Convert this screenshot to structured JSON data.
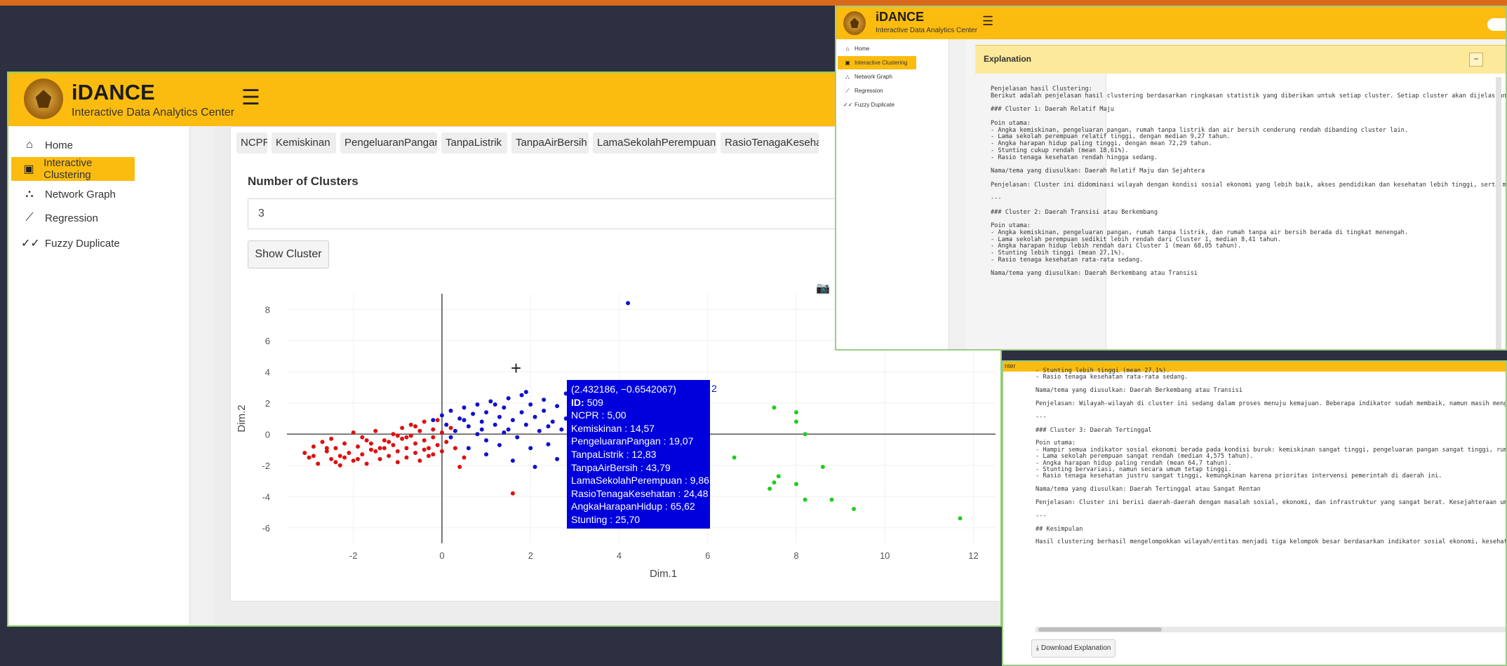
{
  "app": {
    "brand": "iDANCE",
    "subtitle": "Interactive Data Analytics Center"
  },
  "nav": {
    "items": [
      {
        "label": "Home",
        "icon": "home-icon"
      },
      {
        "label": "Interactive Clustering",
        "icon": "clustering-icon"
      },
      {
        "label": "Network Graph",
        "icon": "network-icon"
      },
      {
        "label": "Regression",
        "icon": "line-chart-icon"
      },
      {
        "label": "Fuzzy Duplicate",
        "icon": "double-check-icon"
      }
    ],
    "active_index": 1
  },
  "clustering": {
    "variables": [
      "NCPR",
      "Kemiskinan",
      "PengeluaranPangan",
      "TanpaListrik",
      "TanpaAirBersih",
      "LamaSekolahPerempuan",
      "RasioTenagaKesehatan"
    ],
    "num_clusters_label": "Number of Clusters",
    "num_clusters_value": "3",
    "show_button": "Show Cluster"
  },
  "tooltip": {
    "coords": "(2.432186, −0.6542067)",
    "id_label": "ID:",
    "id_value": "509",
    "cluster_label": "2",
    "rows": [
      "NCPR : 5,00",
      "Kemiskinan : 14,57",
      "PengeluaranPangan : 19,07",
      "TanpaListrik : 12,83",
      "TanpaAirBersih : 43,79",
      "LamaSekolahPerempuan : 9,86",
      "RasioTenagaKesehatan : 24,48",
      "AngkaHarapanHidup : 65,62",
      "Stunting : 25,70"
    ]
  },
  "chart_data": {
    "type": "scatter",
    "xlabel": "Dim.1",
    "ylabel": "Dim.2",
    "xlim": [
      -3.5,
      12.5
    ],
    "ylim": [
      -7.0,
      9.0
    ],
    "xticks": [
      -2,
      0,
      2,
      4,
      6,
      8,
      10,
      12
    ],
    "yticks": [
      -6,
      -4,
      -2,
      0,
      2,
      4,
      6,
      8
    ],
    "colors": {
      "1": "#dd1111",
      "2": "#1111cc",
      "3": "#22cc22"
    },
    "series": [
      {
        "cluster": "1",
        "points": [
          [
            -3.1,
            -1.2
          ],
          [
            -3.0,
            -1.5
          ],
          [
            -2.9,
            -0.8
          ],
          [
            -2.8,
            -1.9
          ],
          [
            -2.7,
            -0.5
          ],
          [
            -2.6,
            -1.1
          ],
          [
            -2.5,
            -1.6
          ],
          [
            -2.5,
            -0.3
          ],
          [
            -2.4,
            -0.9
          ],
          [
            -2.3,
            -1.4
          ],
          [
            -2.3,
            -2.0
          ],
          [
            -2.2,
            -0.6
          ],
          [
            -2.1,
            -1.2
          ],
          [
            -2.0,
            0.1
          ],
          [
            -2.0,
            -1.7
          ],
          [
            -1.9,
            -0.8
          ],
          [
            -1.8,
            -1.3
          ],
          [
            -1.8,
            -0.2
          ],
          [
            -1.7,
            -1.9
          ],
          [
            -1.6,
            -0.6
          ],
          [
            -1.5,
            -1.1
          ],
          [
            -1.5,
            0.2
          ],
          [
            -1.4,
            -1.6
          ],
          [
            -1.3,
            -0.4
          ],
          [
            -1.3,
            -0.9
          ],
          [
            -1.2,
            -1.4
          ],
          [
            -1.1,
            0.0
          ],
          [
            -1.1,
            -0.7
          ],
          [
            -1.0,
            -1.8
          ],
          [
            -1.0,
            -1.1
          ],
          [
            -0.9,
            -0.3
          ],
          [
            -0.9,
            0.4
          ],
          [
            -0.8,
            -0.9
          ],
          [
            -0.8,
            -1.5
          ],
          [
            -0.7,
            -0.1
          ],
          [
            -0.7,
            0.6
          ],
          [
            -0.6,
            -0.6
          ],
          [
            -0.6,
            -1.2
          ],
          [
            -0.5,
            0.2
          ],
          [
            -0.5,
            -1.7
          ],
          [
            -0.4,
            -0.4
          ],
          [
            -0.4,
            0.8
          ],
          [
            -0.3,
            -0.9
          ],
          [
            -0.3,
            -1.4
          ],
          [
            -0.2,
            0.3
          ],
          [
            -0.2,
            -0.2
          ],
          [
            -0.1,
            -0.7
          ],
          [
            -0.1,
            0.9
          ],
          [
            0.0,
            -1.1
          ],
          [
            0.0,
            0.1
          ],
          [
            0.1,
            -0.5
          ],
          [
            0.2,
            0.4
          ],
          [
            0.3,
            -0.9
          ],
          [
            0.4,
            -2.1
          ],
          [
            1.6,
            -3.8
          ],
          [
            -2.6,
            -0.9
          ],
          [
            -2.2,
            -1.5
          ],
          [
            -1.6,
            -1.0
          ],
          [
            -1.2,
            -0.5
          ],
          [
            -0.8,
            -0.2
          ],
          [
            -0.4,
            -1.0
          ],
          [
            -2.9,
            -1.4
          ],
          [
            -1.9,
            -1.6
          ],
          [
            -1.4,
            -0.9
          ],
          [
            -0.6,
            0.5
          ],
          [
            -1.0,
            -0.1
          ],
          [
            -2.4,
            -1.8
          ],
          [
            -1.7,
            -0.4
          ],
          [
            -0.2,
            -1.3
          ],
          [
            0.5,
            -1.5
          ]
        ]
      },
      {
        "cluster": "2",
        "points": [
          [
            -0.2,
            0.9
          ],
          [
            0.0,
            1.2
          ],
          [
            0.1,
            0.6
          ],
          [
            0.2,
            1.5
          ],
          [
            0.3,
            0.2
          ],
          [
            0.4,
            1.0
          ],
          [
            0.5,
            1.7
          ],
          [
            0.6,
            0.5
          ],
          [
            0.7,
            1.3
          ],
          [
            0.8,
            0.0
          ],
          [
            0.8,
            1.9
          ],
          [
            0.9,
            0.8
          ],
          [
            1.0,
            1.4
          ],
          [
            1.0,
            -0.4
          ],
          [
            1.1,
            2.1
          ],
          [
            1.2,
            0.6
          ],
          [
            1.3,
            1.1
          ],
          [
            1.3,
            -0.7
          ],
          [
            1.4,
            1.7
          ],
          [
            1.5,
            0.3
          ],
          [
            1.5,
            2.3
          ],
          [
            1.6,
            0.9
          ],
          [
            1.7,
            -0.2
          ],
          [
            1.8,
            1.4
          ],
          [
            1.8,
            2.5
          ],
          [
            1.9,
            0.6
          ],
          [
            2.0,
            1.9
          ],
          [
            2.0,
            -0.9
          ],
          [
            2.1,
            1.1
          ],
          [
            2.2,
            0.2
          ],
          [
            2.3,
            2.2
          ],
          [
            2.3,
            1.5
          ],
          [
            2.4,
            -0.65
          ],
          [
            2.5,
            0.8
          ],
          [
            2.6,
            1.8
          ],
          [
            2.7,
            0.3
          ],
          [
            2.8,
            2.6
          ],
          [
            2.9,
            1.2
          ],
          [
            3.0,
            -0.3
          ],
          [
            3.1,
            1.6
          ],
          [
            3.2,
            0.6
          ],
          [
            3.3,
            2.2
          ],
          [
            3.5,
            1.0
          ],
          [
            3.7,
            0.4
          ],
          [
            4.0,
            1.3
          ],
          [
            4.2,
            8.4
          ],
          [
            0.6,
            -0.9
          ],
          [
            1.0,
            -1.3
          ],
          [
            1.6,
            -1.7
          ],
          [
            2.1,
            -2.1
          ],
          [
            3.2,
            -0.9
          ],
          [
            2.6,
            -1.6
          ],
          [
            0.2,
            -0.2
          ],
          [
            0.5,
            0.9
          ],
          [
            1.2,
            1.9
          ],
          [
            1.9,
            2.7
          ],
          [
            2.4,
            0.5
          ],
          [
            0.9,
            0.3
          ],
          [
            1.4,
            0.1
          ],
          [
            2.8,
            1.0
          ]
        ]
      },
      {
        "cluster": "3",
        "points": [
          [
            7.5,
            1.7
          ],
          [
            8.0,
            1.4
          ],
          [
            8.0,
            0.8
          ],
          [
            8.2,
            0.0
          ],
          [
            6.6,
            -1.5
          ],
          [
            8.6,
            -2.1
          ],
          [
            7.6,
            -2.7
          ],
          [
            7.5,
            -3.1
          ],
          [
            7.4,
            -3.5
          ],
          [
            8.0,
            -3.2
          ],
          [
            8.2,
            -4.2
          ],
          [
            8.8,
            -4.2
          ],
          [
            9.3,
            -4.8
          ],
          [
            11.7,
            -5.4
          ]
        ]
      }
    ]
  },
  "explanation": {
    "title": "Explanation",
    "collapse_label": "−",
    "lines_top": [
      "Penjelasan hasil Clustering:",
      "Berikut adalah penjelasan hasil clustering berdasarkan ringkasan statistik yang diberikan untuk setiap cluster. Setiap cluster akan dijelaskan",
      "",
      "### Cluster 1: Daerah Relatif Maju",
      "",
      "Poin utama:",
      "- Angka kemiskinan, pengeluaran pangan, rumah tanpa listrik dan air bersih cenderung rendah dibanding cluster lain.",
      "- Lama sekolah perempuan relatif tinggi, dengan median 9,27 tahun.",
      "- Angka harapan hidup paling tinggi, dengan mean 72,29 tahun.",
      "- Stunting cukup rendah (mean 18,61%).",
      "- Rasio tenaga kesehatan rendah hingga sedang.",
      "",
      "Nama/tema yang diusulkan: Daerah Relatif Maju dan Sejahtera",
      "",
      "Penjelasan: Cluster ini didominasi wilayah dengan kondisi sosial ekonomi yang lebih baik, akses pendidikan dan kesehatan lebih tinggi, serta ma",
      "",
      "---",
      "",
      "### Cluster 2: Daerah Transisi atau Berkembang",
      "",
      "Poin utama:",
      "- Angka kemiskinan, pengeluaran pangan, rumah tanpa listrik, dan rumah tanpa air bersih berada di tingkat menengah.",
      "- Lama sekolah perempuan sedikit lebih rendah dari Cluster 1, median 8,41 tahun.",
      "- Angka harapan hidup lebih rendah dari Cluster 1 (mean 68,05 tahun).",
      "- Stunting lebih tinggi (mean 27,1%).",
      "- Rasio tenaga kesehatan rata-rata sedang.",
      "",
      "Nama/tema yang diusulkan: Daerah Berkembang atau Transisi"
    ],
    "lines_bottom": [
      "- Stunting lebih tinggi (mean 27,1%).",
      "- Rasio tenaga kesehatan rata-rata sedang.",
      "",
      "Nama/tema yang diusulkan: Daerah Berkembang atau Transisi",
      "",
      "Penjelasan: Wilayah-wilayah di cluster ini sedang dalam proses menuju kemajuan. Beberapa indikator sudah membaik, namun masih menghadapi tantan",
      "",
      "---",
      "",
      "### Cluster 3: Daerah Tertinggal",
      "",
      "Poin utama:",
      "- Hampir semua indikator sosial ekonomi berada pada kondisi buruk: kemiskinan sangat tinggi, pengeluaran pangan sangat tinggi, rumah tanpa list",
      "- Lama sekolah perempuan sangat rendah (median 4,575 tahun).",
      "- Angka harapan hidup paling rendah (mean 64,7 tahun).",
      "- Stunting bervariasi, namun secara umum tetap tinggi.",
      "- Rasio tenaga kesehatan justru sangat tinggi, kemungkinan karena prioritas intervensi pemerintah di daerah ini.",
      "",
      "Nama/tema yang diusulkan: Daerah Tertinggal atau Sangat Rentan",
      "",
      "Penjelasan: Cluster ini berisi daerah-daerah dengan masalah sosial, ekonomi, dan infrastruktur yang sangat berat. Kesejahteraan umum sangat ren",
      "",
      "---",
      "",
      "## Kesimpulan",
      "",
      "Hasil clustering berhasil mengelompokkan wilayah/entitas menjadi tiga kelompok besar berdasarkan indikator sosial ekonomi, kesehatan, dan infra"
    ],
    "download_label": "Download Explanation",
    "tab_fragment": "nter"
  }
}
